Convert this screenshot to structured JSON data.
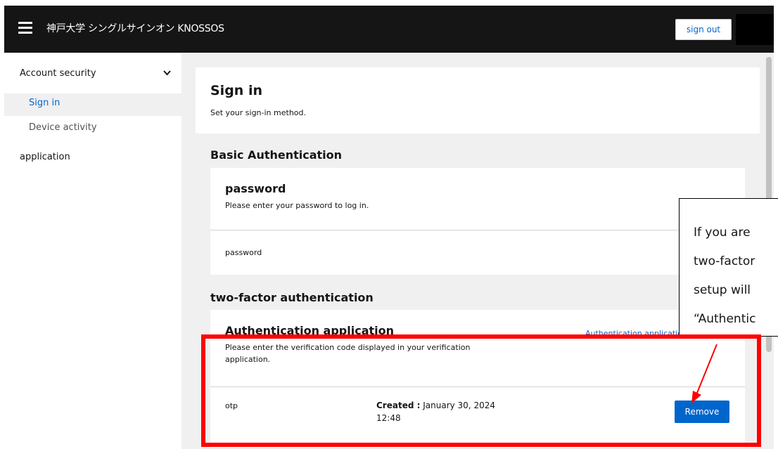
{
  "header": {
    "title": "神戸大学 シングルサインオン KNOSSOS",
    "signout_label": "sign out"
  },
  "sidebar": {
    "items": [
      {
        "label": "Account security"
      },
      {
        "label": "Sign in"
      },
      {
        "label": "Device activity"
      },
      {
        "label": "application"
      }
    ]
  },
  "page": {
    "title": "Sign in",
    "subtitle": "Set your sign-in method."
  },
  "basic": {
    "section_title": "Basic Authentication",
    "card_title": "password",
    "card_desc": "Please enter your password to log in.",
    "row_label": "password"
  },
  "twofactor": {
    "section_title": "two-factor authentication",
    "card_title": "Authentication application",
    "card_desc_line1": "Please enter the verification code displayed in your verification",
    "card_desc_line2": "application.",
    "link_label": "Authentication application",
    "row_label": "otp",
    "created_label": "Created :",
    "created_date": "January 30, 2024",
    "created_time": "12:48",
    "remove_label": "Remove"
  },
  "callout": {
    "lines": [
      "If you are",
      "two-factor",
      "setup will",
      "“Authentic"
    ]
  },
  "colors": {
    "accent": "#0066cc",
    "topbar": "#151515",
    "highlight": "#ff0000",
    "background": "#f0f0f0"
  }
}
